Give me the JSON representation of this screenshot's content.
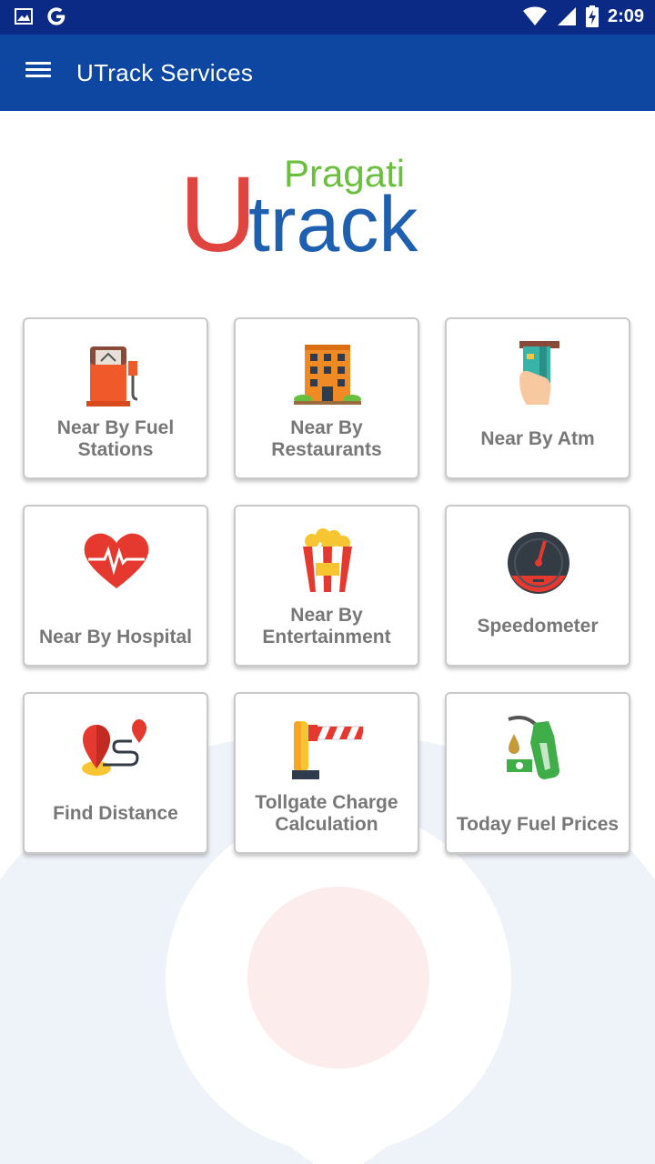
{
  "status_bar": {
    "time": "2:09",
    "icons": [
      "image-icon",
      "google-icon",
      "wifi-icon",
      "signal-icon",
      "battery-charging-icon"
    ]
  },
  "app_bar": {
    "title": "UTrack Services",
    "menu_icon": "hamburger-menu-icon"
  },
  "logo": {
    "top_word": "Pragati",
    "brand_u": "U",
    "brand_rest": "track",
    "colors": {
      "u": "#e0443f",
      "pragati": "#6bbf3f",
      "track": "#1f5fb0"
    }
  },
  "tiles": [
    {
      "label": "Near By Fuel Stations",
      "icon": "fuel-pump-icon"
    },
    {
      "label": "Near By Restaurants",
      "icon": "building-icon"
    },
    {
      "label": "Near By Atm",
      "icon": "atm-card-icon"
    },
    {
      "label": "Near By Hospital",
      "icon": "heart-pulse-icon"
    },
    {
      "label": "Near By Entertainment",
      "icon": "popcorn-icon"
    },
    {
      "label": "Speedometer",
      "icon": "speedometer-icon"
    },
    {
      "label": "Find Distance",
      "icon": "map-route-icon"
    },
    {
      "label": "Tollgate Charge Calculation",
      "icon": "toll-barrier-icon"
    },
    {
      "label": "Today Fuel Prices",
      "icon": "fuel-nozzle-icon"
    }
  ],
  "colors": {
    "status_bar": "#0b2a86",
    "app_bar": "#0d47a1",
    "tile_text": "#777777"
  }
}
